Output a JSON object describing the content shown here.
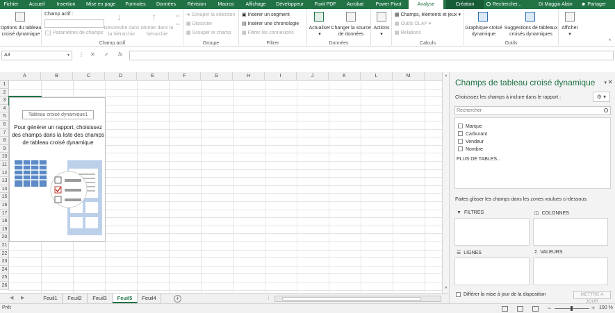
{
  "tabs": [
    {
      "label": "Fichier"
    },
    {
      "label": "Accueil"
    },
    {
      "label": "Insertion"
    },
    {
      "label": "Mise en page"
    },
    {
      "label": "Formules"
    },
    {
      "label": "Données"
    },
    {
      "label": "Révision"
    },
    {
      "label": "Macros"
    },
    {
      "label": "Affichage"
    },
    {
      "label": "Développeur"
    },
    {
      "label": "Foxit PDF"
    },
    {
      "label": "Acrobat"
    },
    {
      "label": "Power Pivot"
    },
    {
      "label": "Analyse"
    },
    {
      "label": "Création"
    }
  ],
  "tell_me": "Rechercher...",
  "user": "Di Maggio Alain",
  "share": "Partager",
  "ribbon": {
    "options_line1": "Options du tableau",
    "options_line2": "croisé dynamique",
    "active_field_label": "Champ actif :",
    "field_settings": "Paramètres de champs",
    "drill_down_line1": "Descendre dans",
    "drill_down_line2": "la hiérarchie",
    "drill_up_line1": "Monter dans la",
    "drill_up_line2": "hiérarchie",
    "group_active_field": "Champ actif",
    "group_selection": "Grouper la sélection",
    "ungroup": "Dissocier",
    "group_field": "Grouper le champ",
    "group_group": "Groupe",
    "insert_slicer": "Insérer un segment",
    "insert_timeline": "Insérer une chronologie",
    "filter_connections": "Filtrer les connexions",
    "group_filter": "Filtrer",
    "refresh": "Actualiser",
    "change_source_line1": "Changer la source",
    "change_source_line2": "de données",
    "group_data": "Données",
    "actions": "Actions",
    "fields_items_sets": "Champs, éléments et jeux",
    "olap_tools": "Outils OLAP",
    "relationships": "Relations",
    "group_calculations": "Calculs",
    "pivotchart_line1": "Graphique croisé",
    "pivotchart_line2": "dynamique",
    "recommended_line1": "Suggestions de tableaux",
    "recommended_line2": "croisés dynamiques",
    "show": "Afficher",
    "group_tools": "Outils"
  },
  "formula_bar": {
    "name_box": "A3",
    "cancel_glyph": "✕",
    "enter_glyph": "✓",
    "fx_glyph": "fx",
    "formula": ""
  },
  "grid": {
    "columns": [
      "A",
      "B",
      "C",
      "D",
      "E",
      "F",
      "G",
      "H",
      "I",
      "J",
      "K",
      "L",
      "M"
    ],
    "rows": [
      "1",
      "2",
      "3",
      "4",
      "5",
      "6",
      "7",
      "8",
      "9",
      "10",
      "11",
      "12",
      "13",
      "14",
      "15",
      "16",
      "17",
      "18",
      "19",
      "20",
      "21",
      "22",
      "23",
      "24",
      "25",
      "26"
    ]
  },
  "pivot_placeholder": {
    "title": "Tableau croisé dynamique1",
    "instructions": "Pour générer un rapport, choisissez des champs dans la liste des champs de tableau croisé dynamique"
  },
  "sheets": {
    "tabs": [
      {
        "label": "Feuil1",
        "active": false
      },
      {
        "label": "Feuil2",
        "active": false
      },
      {
        "label": "Feuil3",
        "active": false
      },
      {
        "label": "Feuil5",
        "active": true
      },
      {
        "label": "Feuil4",
        "active": false
      }
    ],
    "add_glyph": "+"
  },
  "status_bar": {
    "mode": "Prêt",
    "zoom": "100 %"
  },
  "field_pane": {
    "title": "Champs de tableau croisé dynamique",
    "subtitle": "Choisissez les champs à inclure dans le rapport :",
    "search_placeholder": "Rechercher",
    "fields": [
      {
        "label": "Marque",
        "checked": false
      },
      {
        "label": "Carburant",
        "checked": false
      },
      {
        "label": "Vendeur",
        "checked": false
      },
      {
        "label": "Nombre",
        "checked": false
      }
    ],
    "more_tables": "PLUS DE TABLES...",
    "drag_hint": "Faites glisser les champs dans les zones voulues ci-dessous:",
    "areas": {
      "filters": "FILTRES",
      "columns": "COLONNES",
      "rows": "LIGNES",
      "values": "VALEURS"
    },
    "defer_update": "Différer la mise à jour de la disposition",
    "update_button": "METTRE À JOUR"
  },
  "colors": {
    "accent": "#217346",
    "ribbon_tab_bar": "#217346",
    "context_tab": "#185c37",
    "pane_background": "#f3f3f3"
  }
}
